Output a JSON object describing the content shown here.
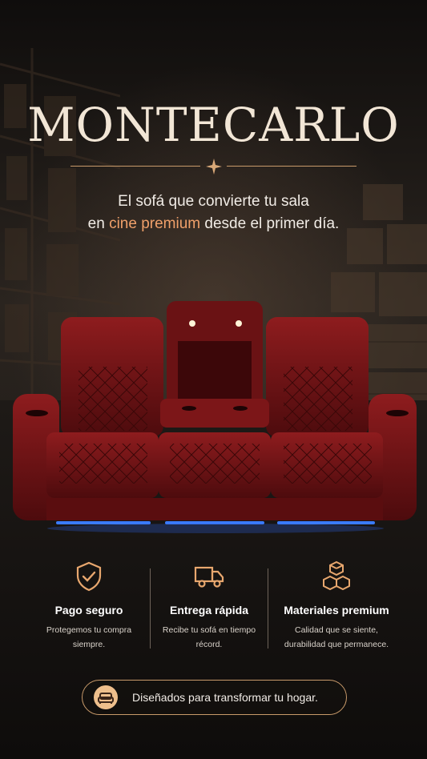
{
  "brand": {
    "name": "MONTECARLO"
  },
  "tagline": {
    "line1": "El sofá que convierte tu sala",
    "line2_prefix": "en",
    "line2_accent": "cine premium",
    "line2_suffix": "desde el primer día."
  },
  "features": [
    {
      "icon": "shield-check-icon",
      "title": "Pago seguro",
      "desc_line1": "Protegemos tu compra",
      "desc_line2": "siempre."
    },
    {
      "icon": "delivery-truck-icon",
      "title": "Entrega rápida",
      "desc_line1": "Recibe tu sofá en tiempo",
      "desc_line2": "récord."
    },
    {
      "icon": "stacked-boxes-icon",
      "title": "Materiales premium",
      "desc_line1": "Calidad que se siente,",
      "desc_line2": "durabilidad que permanece."
    }
  ],
  "footer_pill": {
    "icon": "sofa-icon",
    "text": "Diseñados para transformar tu hogar."
  },
  "colors": {
    "accent": "#f0a06a",
    "gold": "#c89a6a",
    "leather": "#7a1416",
    "led": "#3b7bff"
  }
}
